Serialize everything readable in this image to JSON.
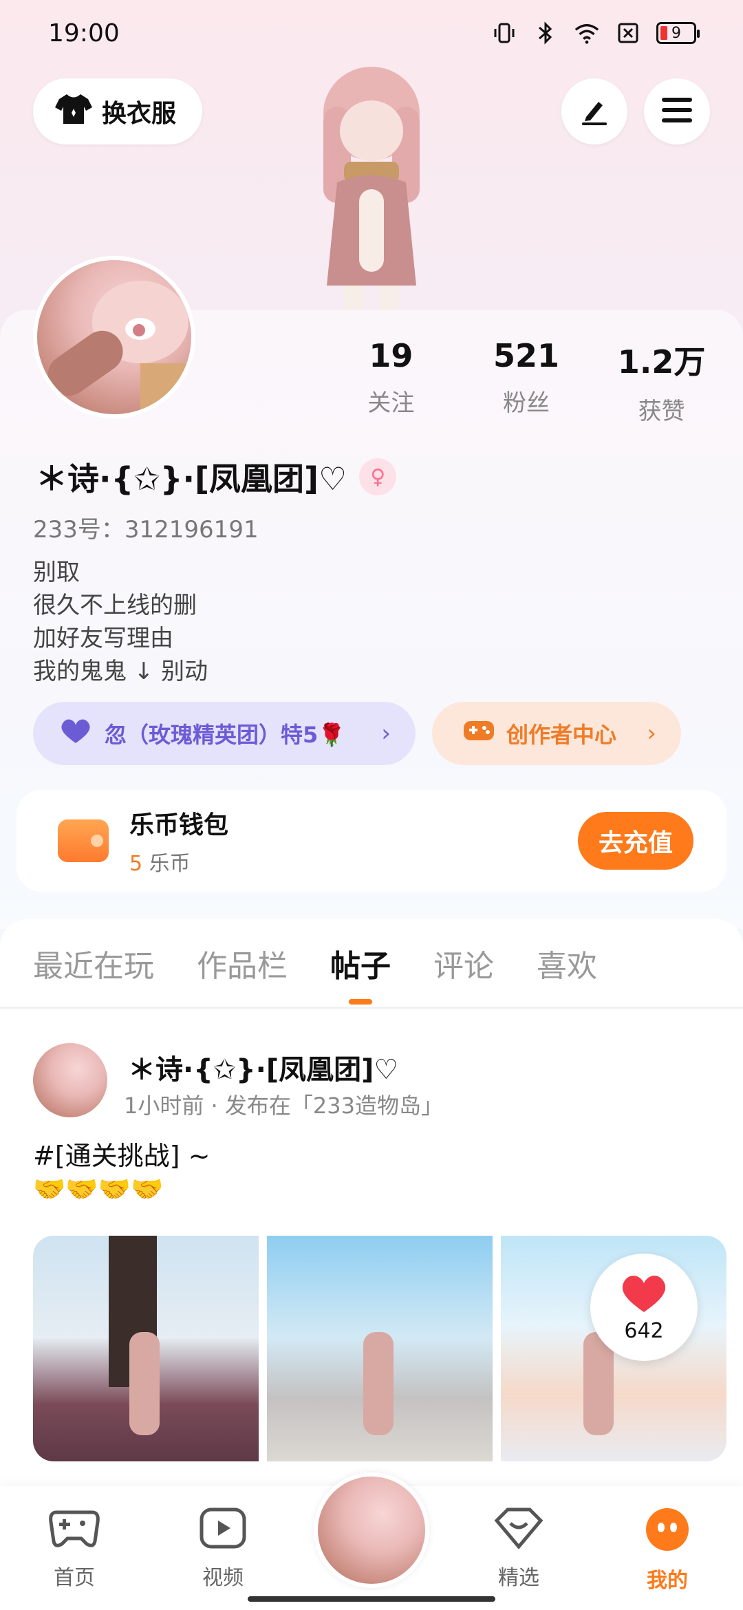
{
  "status_bar": {
    "time": "19:00",
    "battery": "9"
  },
  "header": {
    "outfit_label": "换衣服"
  },
  "profile": {
    "stats": [
      {
        "value": "19",
        "label": "关注"
      },
      {
        "value": "521",
        "label": "粉丝"
      },
      {
        "value": "1.2万",
        "label": "获赞"
      }
    ],
    "nickname": "＊诗·{✩}·[凤凰团]♡",
    "uid": "233号：312196191",
    "bio": [
      "别取",
      "很久不上线的删",
      "加好友写理由",
      "我的鬼鬼 ↓ 别动"
    ],
    "club_pill": "忽（玫瑰精英团）特5🌹",
    "creator_pill": "创作者中心"
  },
  "wallet": {
    "title": "乐币钱包",
    "amount": "5",
    "unit": "乐币",
    "recharge": "去充值"
  },
  "tabs": [
    "最近在玩",
    "作品栏",
    "帖子",
    "评论",
    "喜欢"
  ],
  "post": {
    "author": "＊诗·{✩}·[凤凰团]♡",
    "meta": "1小时前 · 发布在「233造物岛」",
    "text_line1": "#[通关挑战] ~",
    "text_line2": "🤝🤝🤝🤝",
    "likes": "642"
  },
  "bottom_nav": [
    "首页",
    "视频",
    "精选",
    "我的"
  ],
  "colors": {
    "accent": "#ff7a1a",
    "club": "#6b5cd6"
  }
}
